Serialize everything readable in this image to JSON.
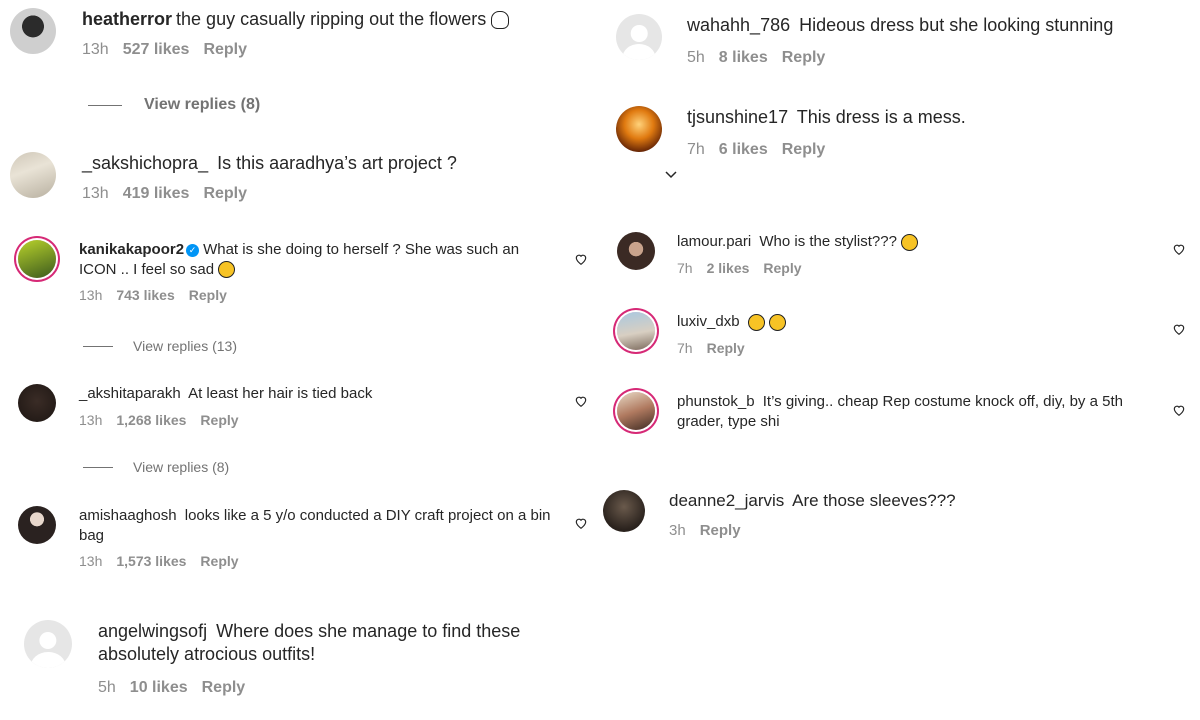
{
  "icons": {
    "heart": "heart-icon",
    "verified": "verified-badge-icon",
    "chevron": "chevron-down-icon"
  },
  "colors": {
    "meta": "#8e8e8e",
    "ring": "#d62976",
    "verified": "#0095f6",
    "text": "#262626"
  },
  "reply_label": "Reply",
  "comments": [
    {
      "user": "heatherror",
      "text": "the guy casually ripping out the flowers",
      "emoji": "skull",
      "time": "13h",
      "likes": "527 likes",
      "replies": "View replies (8)"
    },
    {
      "user": "_sakshichopra_",
      "text": "Is this aaradhya’s art project ?",
      "time": "13h",
      "likes": "419 likes"
    },
    {
      "user": "kanikakapoor2",
      "verified": true,
      "text": "What is she doing to herself ? She was such an ICON .. I feel so sad",
      "emoji": "sad-face",
      "time": "13h",
      "likes": "743 likes",
      "replies": "View replies (13)"
    },
    {
      "user": "_akshitaparakh",
      "text": "At least her hair is tied back",
      "time": "13h",
      "likes": "1,268 likes",
      "replies": "View replies (8)"
    },
    {
      "user": "amishaaghosh",
      "text": "looks like a 5 y/o conducted a DIY craft project on a bin bag",
      "time": "13h",
      "likes": "1,573 likes"
    },
    {
      "user": "angelwingsofj",
      "text": "Where does she manage to find these absolutely atrocious outfits!",
      "time": "5h",
      "likes": "10 likes"
    },
    {
      "user": "wahahh_786",
      "text": "Hideous dress but she looking stunning",
      "time": "5h",
      "likes": "8 likes"
    },
    {
      "user": "tjsunshine17",
      "text": "This dress is a mess.",
      "time": "7h",
      "likes": "6 likes"
    },
    {
      "user": "lamour.pari",
      "text": "Who is the stylist???",
      "emoji": "surprised-face",
      "time": "7h",
      "likes": "2 likes"
    },
    {
      "user": "luxiv_dxb",
      "text": "",
      "emoji": "two-sad-faces",
      "time": "7h"
    },
    {
      "user": "phunstok_b",
      "text": "It’s giving.. cheap Rep costume knock off, diy, by a 5th grader, type shi"
    },
    {
      "user": "deanne2_jarvis",
      "text": "Are those sleeves???",
      "time": "3h"
    }
  ]
}
